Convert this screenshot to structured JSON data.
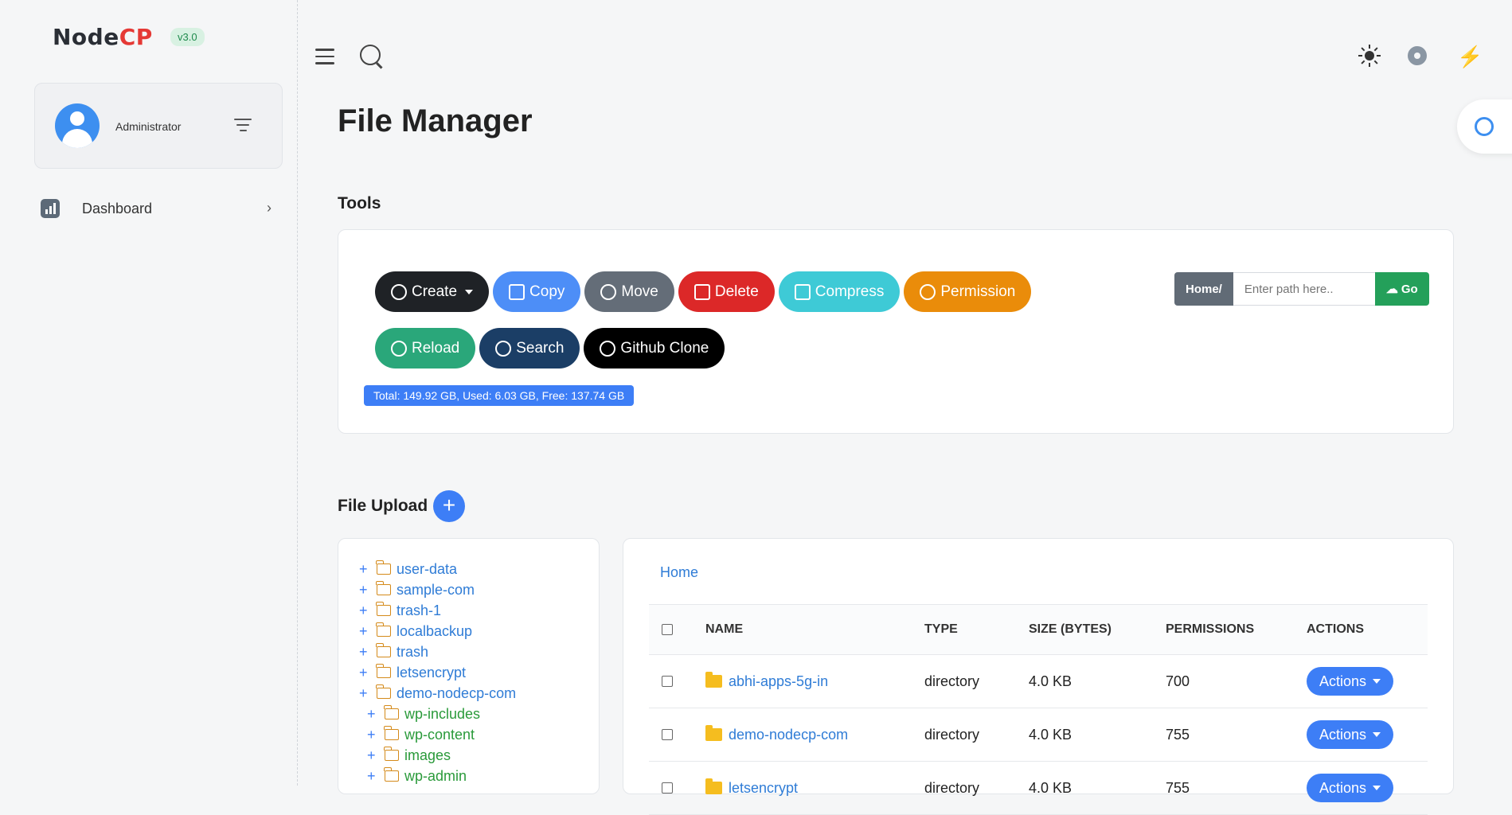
{
  "brand": {
    "logo_node": "Node",
    "logo_cp": "CP",
    "version": "v3.0"
  },
  "user": {
    "name": "Administrator"
  },
  "sidebar": {
    "items": [
      {
        "label": "Dashboard",
        "icon": "chart-icon"
      }
    ]
  },
  "page": {
    "title": "File Manager"
  },
  "tools": {
    "title": "Tools",
    "buttons": [
      {
        "label": "Create",
        "color": "#1f2226",
        "icon": "plus-circle-icon",
        "dropdown": true
      },
      {
        "label": "Copy",
        "color": "#4d8ef7",
        "icon": "copy-icon"
      },
      {
        "label": "Move",
        "color": "#646d78",
        "icon": "move-icon"
      },
      {
        "label": "Delete",
        "color": "#dc2828",
        "icon": "trash-icon"
      },
      {
        "label": "Compress",
        "color": "#3ecad6",
        "icon": "compress-icon"
      },
      {
        "label": "Permission",
        "color": "#ea8c0a",
        "icon": "aperture-icon"
      },
      {
        "label": "Reload",
        "color": "#2aa77a",
        "icon": "refresh-icon"
      },
      {
        "label": "Search",
        "color": "#1b3e66",
        "icon": "search-icon"
      },
      {
        "label": "Github Clone",
        "color": "#000000",
        "icon": "github-icon"
      }
    ],
    "disk_usage": "Total: 149.92 GB, Used: 6.03 GB, Free: 137.74 GB",
    "path_prefix": "Home/",
    "path_placeholder": "Enter path here..",
    "go_label": "Go"
  },
  "upload": {
    "title": "File Upload"
  },
  "tree": {
    "items": [
      {
        "label": "user-data",
        "level": 0,
        "color": "blue"
      },
      {
        "label": "sample-com",
        "level": 0,
        "color": "blue"
      },
      {
        "label": "trash-1",
        "level": 0,
        "color": "blue"
      },
      {
        "label": "localbackup",
        "level": 0,
        "color": "blue"
      },
      {
        "label": "trash",
        "level": 0,
        "color": "blue"
      },
      {
        "label": "letsencrypt",
        "level": 0,
        "color": "blue"
      },
      {
        "label": "demo-nodecp-com",
        "level": 0,
        "color": "blue"
      },
      {
        "label": "wp-includes",
        "level": 1,
        "color": "green"
      },
      {
        "label": "wp-content",
        "level": 1,
        "color": "green"
      },
      {
        "label": "images",
        "level": 1,
        "color": "green"
      },
      {
        "label": "wp-admin",
        "level": 1,
        "color": "green"
      }
    ]
  },
  "files": {
    "breadcrumb": "Home",
    "columns": [
      "NAME",
      "TYPE",
      "SIZE (BYTES)",
      "PERMISSIONS",
      "ACTIONS"
    ],
    "rows": [
      {
        "name": "abhi-apps-5g-in",
        "type": "directory",
        "size": "4.0 KB",
        "perm": "700",
        "action": "Actions"
      },
      {
        "name": "demo-nodecp-com",
        "type": "directory",
        "size": "4.0 KB",
        "perm": "755",
        "action": "Actions"
      },
      {
        "name": "letsencrypt",
        "type": "directory",
        "size": "4.0 KB",
        "perm": "755",
        "action": "Actions"
      }
    ]
  }
}
